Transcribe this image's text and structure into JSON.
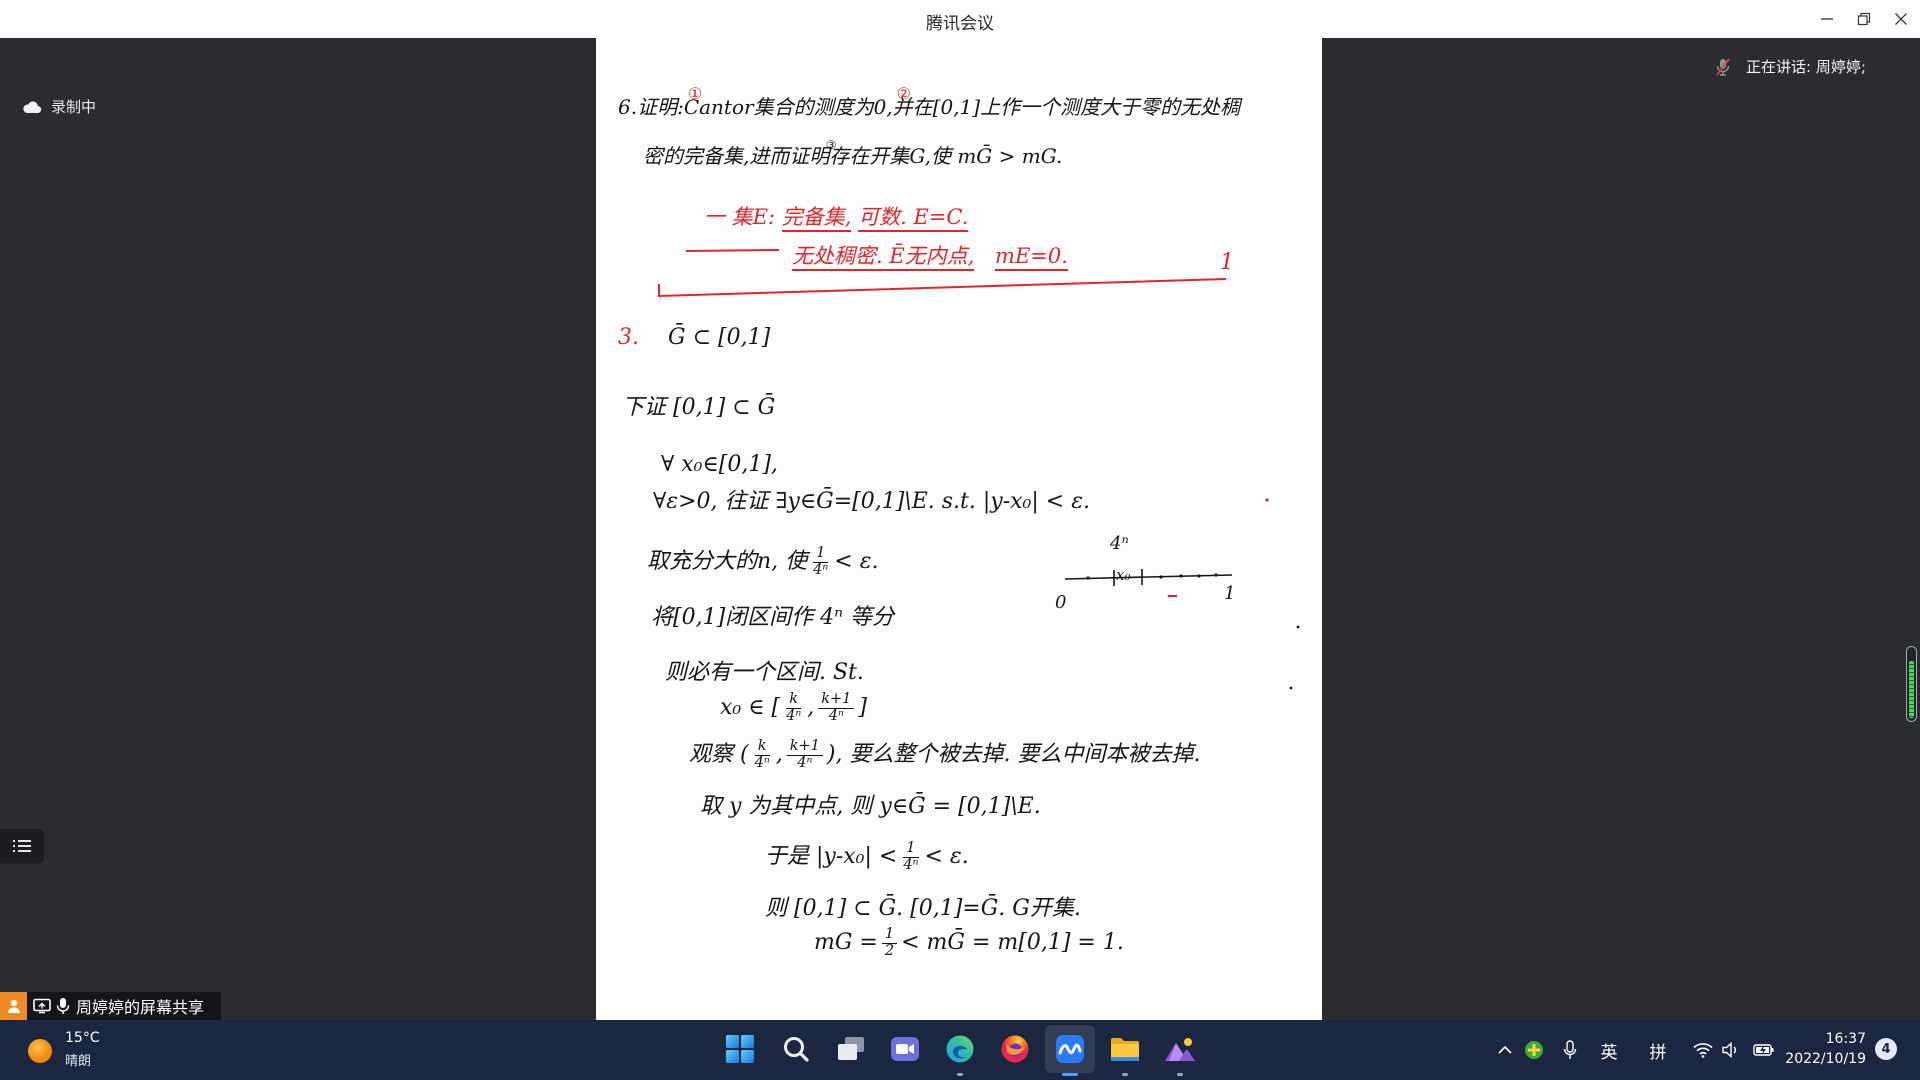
{
  "window": {
    "title": "腾讯会议",
    "controls": [
      "minimize-icon",
      "restore-icon",
      "close-icon"
    ]
  },
  "recording": {
    "icon": "cloud-icon",
    "label": "录制中"
  },
  "speaking": {
    "icon": "mic-muted-icon",
    "label": "正在讲话: 周婷婷;"
  },
  "share_bar": {
    "icons": [
      "user-icon",
      "screen-share-icon",
      "mic-icon"
    ],
    "label": "周婷婷的屏幕共享"
  },
  "side_menu": {
    "icon": "list-icon"
  },
  "shared_screen": {
    "problem": {
      "l1_a": "6.证明:",
      "mark1": "①",
      "l1_b": "Cantor集合的测度为0,",
      "mark2": "②",
      "l1_c": "并在[0,1]上作一个测度大于零的无处稠",
      "l2_a": "密的完备集,进而证明",
      "mark3": "③",
      "l2_b": "存在开集G,使 mḠ > mG."
    },
    "annotation": {
      "l1_a": "一 集E:",
      "l1_b": "完备集,",
      "l1_c": "可数. E=C.",
      "l2_a": "无处稠密. Ē无内点,",
      "l2_b": "mE=0.",
      "bracket_end": "1"
    },
    "proof": {
      "claim_label": "3.",
      "claim": "Ḡ ⊂ [0,1]",
      "to_show": "下证 [0,1] ⊂ Ḡ",
      "for_all_x": "∀ x₀∈[0,1],",
      "for_all_eps": "∀ε>0, 往证 ∃y∈Ḡ=[0,1]\\E. s.t. |y-x₀| < ε.",
      "choose_n": {
        "pre": "取充分大的n, 使",
        "num": "1",
        "den": "4ⁿ",
        "post": "< ε."
      },
      "divide": "将[0,1]闭区间作 4ⁿ 等分",
      "exists": "则必有一个区间. St.",
      "interval": {
        "pre": "x₀ ∈ [",
        "a_num": "k",
        "a_den": "4ⁿ",
        "sep": ",",
        "b_num": "k+1",
        "b_den": "4ⁿ",
        "post": "]"
      },
      "observe": {
        "pre": "观察 (",
        "a_num": "k",
        "a_den": "4ⁿ",
        "sep": ",",
        "b_num": "k+1",
        "b_den": "4ⁿ",
        "post": "), 要么整个被去掉. 要么中间本被去掉."
      },
      "midpoint": "取 y 为其中点, 则 y∈Ḡ = [0,1]\\E.",
      "hence": {
        "pre": "于是 |y-x₀| <",
        "num": "1",
        "den": "4ⁿ",
        "post": "< ε."
      },
      "conclude": "则 [0,1] ⊂ Ḡ.   [0,1]=Ḡ.   G开集.",
      "measure": {
        "pre": "mG =",
        "num": "1",
        "den": "2",
        "post": "< mḠ = m[0,1] = 1."
      }
    },
    "diagram": {
      "top_label": "4ⁿ",
      "left_label": "0",
      "right_label": "1",
      "point_label": "x₀"
    }
  },
  "taskbar": {
    "weather": {
      "icon": "sun-icon",
      "temp": "15°C",
      "condition": "晴朗"
    },
    "apps": [
      {
        "icon": "windows-start-icon"
      },
      {
        "icon": "search-icon"
      },
      {
        "icon": "task-view-icon"
      },
      {
        "icon": "chat-icon"
      },
      {
        "icon": "edge-icon"
      },
      {
        "icon": "firefox-icon"
      },
      {
        "icon": "tencent-meeting-icon",
        "active": true
      },
      {
        "icon": "file-explorer-icon"
      },
      {
        "icon": "photos-icon"
      }
    ],
    "tray": {
      "icons": [
        "chevron-up-icon",
        "tray-app-icon",
        "mic-icon",
        "wifi-icon",
        "speaker-icon",
        "battery-icon"
      ],
      "ime_lang": "英",
      "ime_mode": "拼",
      "time": "16:37",
      "date": "2022/10/19",
      "notifications": "4"
    }
  },
  "colors": {
    "background": "#2b2c2f",
    "taskbar": "#1b2640",
    "ink": "#161616",
    "annotation": "#e0262b",
    "accent": "#2a7bf6",
    "recording_share": "#f08a24"
  }
}
